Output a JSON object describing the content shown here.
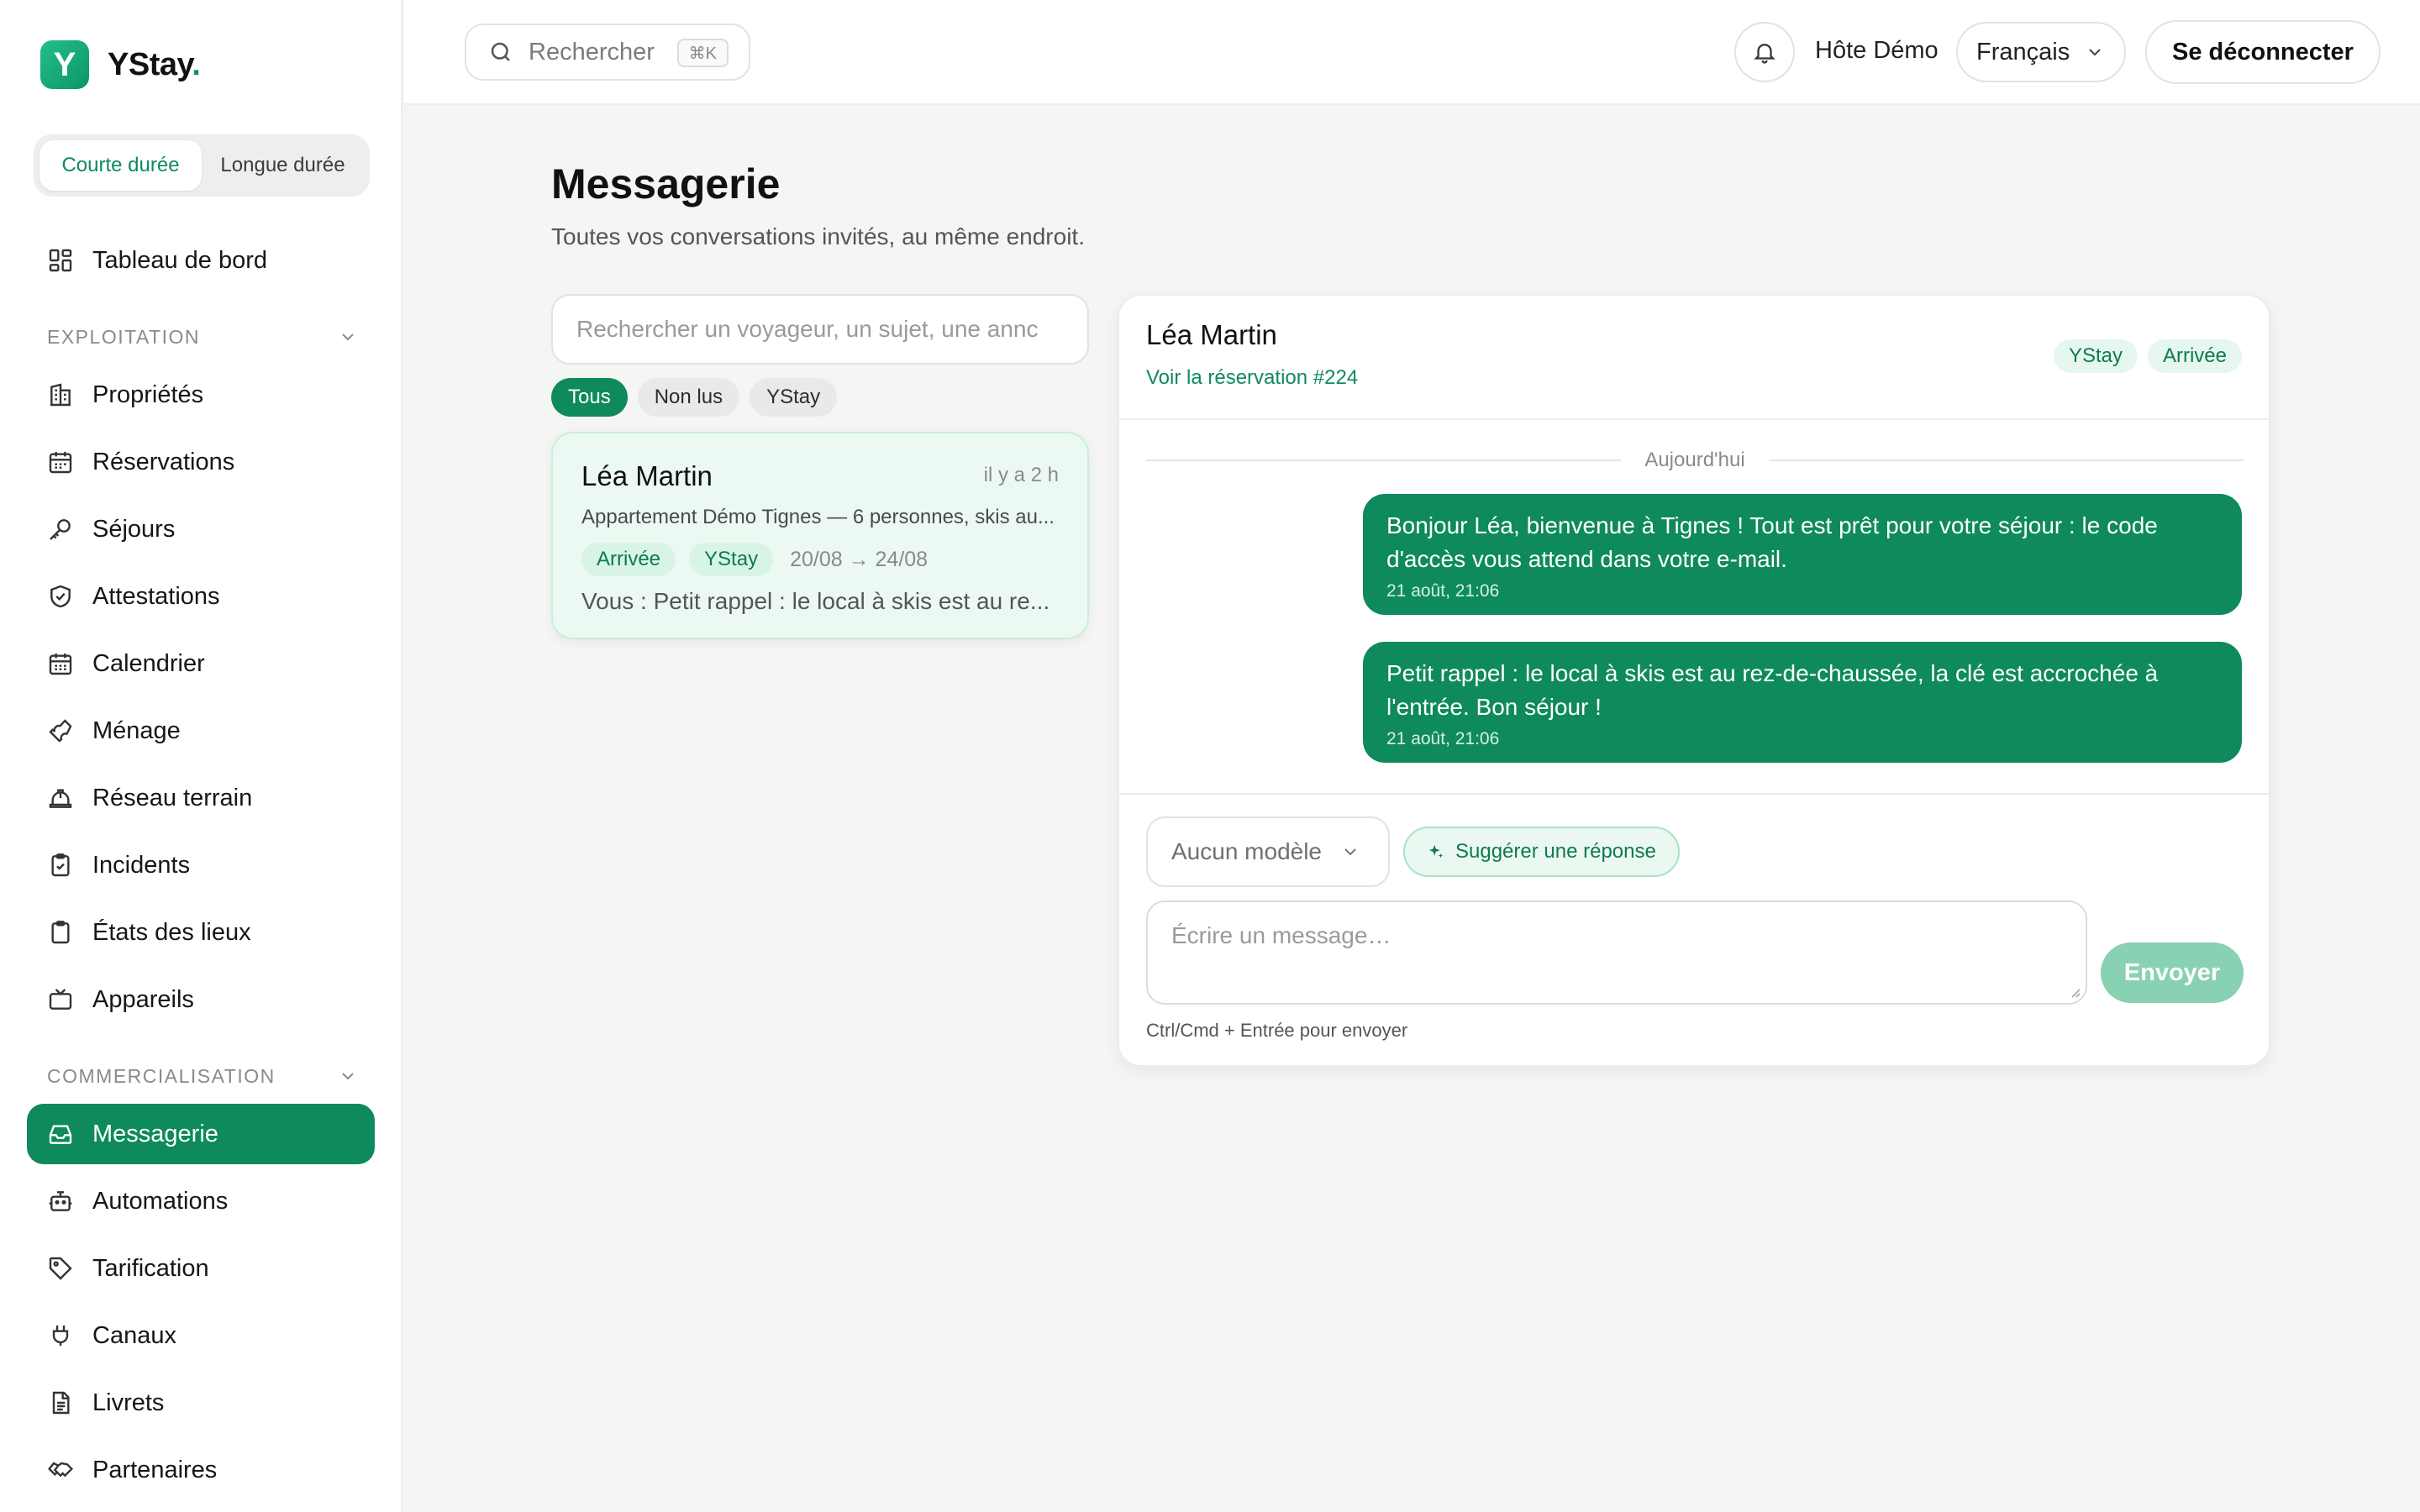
{
  "brand": {
    "name": "YStay",
    "dot": ".",
    "mark": "Y"
  },
  "mode_tabs": [
    "Courte durée",
    "Longue durée"
  ],
  "nav": {
    "dashboard": "Tableau de bord",
    "section_exploitation": "EXPLOITATION",
    "exploitation": [
      {
        "label": "Propriétés",
        "icon": "building-icon"
      },
      {
        "label": "Réservations",
        "icon": "calendar-icon"
      },
      {
        "label": "Séjours",
        "icon": "key-icon"
      },
      {
        "label": "Attestations",
        "icon": "shield-check-icon"
      },
      {
        "label": "Calendrier",
        "icon": "calendar-grid-icon"
      },
      {
        "label": "Ménage",
        "icon": "wrench-icon"
      },
      {
        "label": "Réseau terrain",
        "icon": "hard-hat-icon"
      },
      {
        "label": "Incidents",
        "icon": "clipboard-check-icon"
      },
      {
        "label": "États des lieux",
        "icon": "clipboard-icon"
      },
      {
        "label": "Appareils",
        "icon": "tv-icon"
      }
    ],
    "section_commercialisation": "COMMERCIALISATION",
    "commercialisation": [
      {
        "label": "Messagerie",
        "icon": "inbox-icon"
      },
      {
        "label": "Automations",
        "icon": "bot-icon"
      },
      {
        "label": "Tarification",
        "icon": "tag-icon"
      },
      {
        "label": "Canaux",
        "icon": "plug-icon"
      },
      {
        "label": "Livrets",
        "icon": "document-icon"
      },
      {
        "label": "Partenaires",
        "icon": "handshake-icon"
      }
    ]
  },
  "topbar": {
    "search_placeholder": "Rechercher",
    "search_shortcut": "⌘K",
    "host_name": "Hôte Démo",
    "language": "Français",
    "logout": "Se déconnecter"
  },
  "page": {
    "title": "Messagerie",
    "subtitle": "Toutes vos conversations invités, au même endroit."
  },
  "list": {
    "search_placeholder": "Rechercher un voyageur, un sujet, une annc",
    "filters": [
      "Tous",
      "Non lus",
      "YStay"
    ],
    "conversations": [
      {
        "name": "Léa Martin",
        "time": "il y a 2 h",
        "property": "Appartement Démo Tignes — 6 personnes, skis au...",
        "status": "Arrivée",
        "channel": "YStay",
        "dates": "20/08 → 24/08",
        "last_message": "Vous : Petit rappel : le local à skis est au re..."
      }
    ]
  },
  "chat": {
    "guest": "Léa Martin",
    "reservation_link": "Voir la réservation #224",
    "tags": [
      "YStay",
      "Arrivée"
    ],
    "day_label": "Aujourd'hui",
    "messages": [
      {
        "text": "Bonjour Léa, bienvenue à Tignes ! Tout est prêt pour votre séjour : le code d'accès vous attend dans votre e-mail.",
        "time": "21 août, 21:06"
      },
      {
        "text": "Petit rappel : le local à skis est au rez-de-chaussée, la clé est accrochée à l'entrée. Bon séjour !",
        "time": "21 août, 21:06"
      }
    ],
    "template_select": "Aucun modèle",
    "suggest_label": "Suggérer une réponse",
    "input_placeholder": "Écrire un message…",
    "send_label": "Envoyer",
    "hint": "Ctrl/Cmd + Entrée pour envoyer"
  },
  "colors": {
    "accent": "#0e8a5d",
    "accent_light": "#ecf9f3",
    "background": "#f5f5f4"
  }
}
